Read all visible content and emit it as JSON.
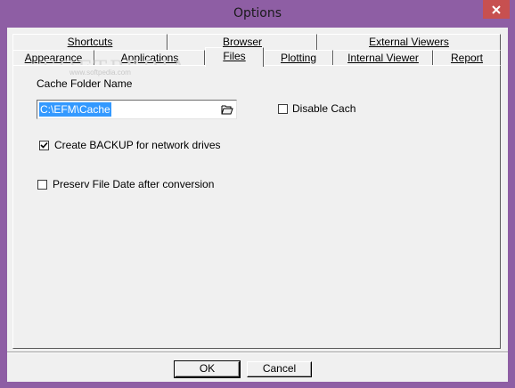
{
  "window": {
    "title": "Options"
  },
  "watermark": {
    "text": "SOFTPEDIA",
    "sub": "www.softpedia.com"
  },
  "tabs": {
    "row1": [
      "Shortcuts",
      "Browser",
      "External Viewers"
    ],
    "row2": [
      "Appearance",
      "Applications",
      "Files",
      "Plotting",
      "Internal Viewer",
      "Report"
    ],
    "active": "Files"
  },
  "files": {
    "cache_label": "Cache Folder Name",
    "cache_value": "C:\\EFM\\Cache",
    "disable_cache": {
      "label": "Disable Cach",
      "checked": false
    },
    "backup": {
      "label": "Create BACKUP for network drives",
      "checked": true
    },
    "preserve": {
      "label": "Preserv File Date after conversion",
      "checked": false
    }
  },
  "buttons": {
    "ok": "OK",
    "cancel": "Cancel"
  },
  "colors": {
    "titlebar": "#8e5ea4",
    "close": "#c75050",
    "selection": "#3399ff"
  }
}
